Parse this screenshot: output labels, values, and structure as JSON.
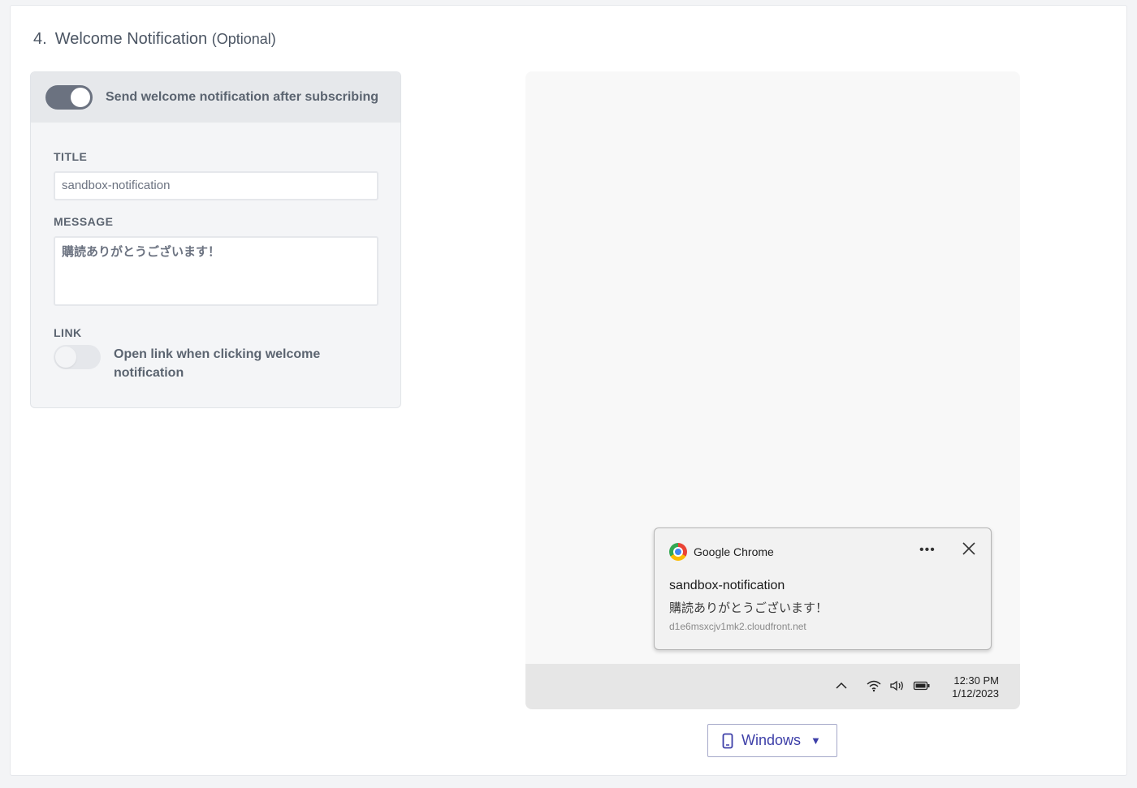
{
  "section": {
    "number": "4.",
    "title": "Welcome Notification",
    "optional": "(Optional)"
  },
  "settings": {
    "send_toggle_label": "Send welcome notification after subscribing",
    "send_toggle_on": true,
    "title_label": "TITLE",
    "title_value": "sandbox-notification",
    "message_label": "MESSAGE",
    "message_value": "購読ありがとうございます！",
    "link_label": "LINK",
    "link_toggle_label": "Open link when clicking welcome notification",
    "link_toggle_on": false
  },
  "preview": {
    "app_name": "Google Chrome",
    "more_icon": "more-dots-icon",
    "close_icon": "close-icon",
    "notif_title": "sandbox-notification",
    "notif_message": "購読ありがとうございます！",
    "notif_url": "d1e6msxcjv1mk2.cloudfront.net",
    "taskbar": {
      "time": "12:30 PM",
      "date": "1/12/2023",
      "icons": [
        "chevron-up-icon",
        "wifi-icon",
        "volume-icon",
        "battery-icon"
      ]
    }
  },
  "os_select": {
    "value": "Windows",
    "icon": "device-icon"
  },
  "colors": {
    "accent": "#3d3fa8",
    "toggle_on": "#6b7280",
    "panel_bg": "#f4f5f7"
  }
}
